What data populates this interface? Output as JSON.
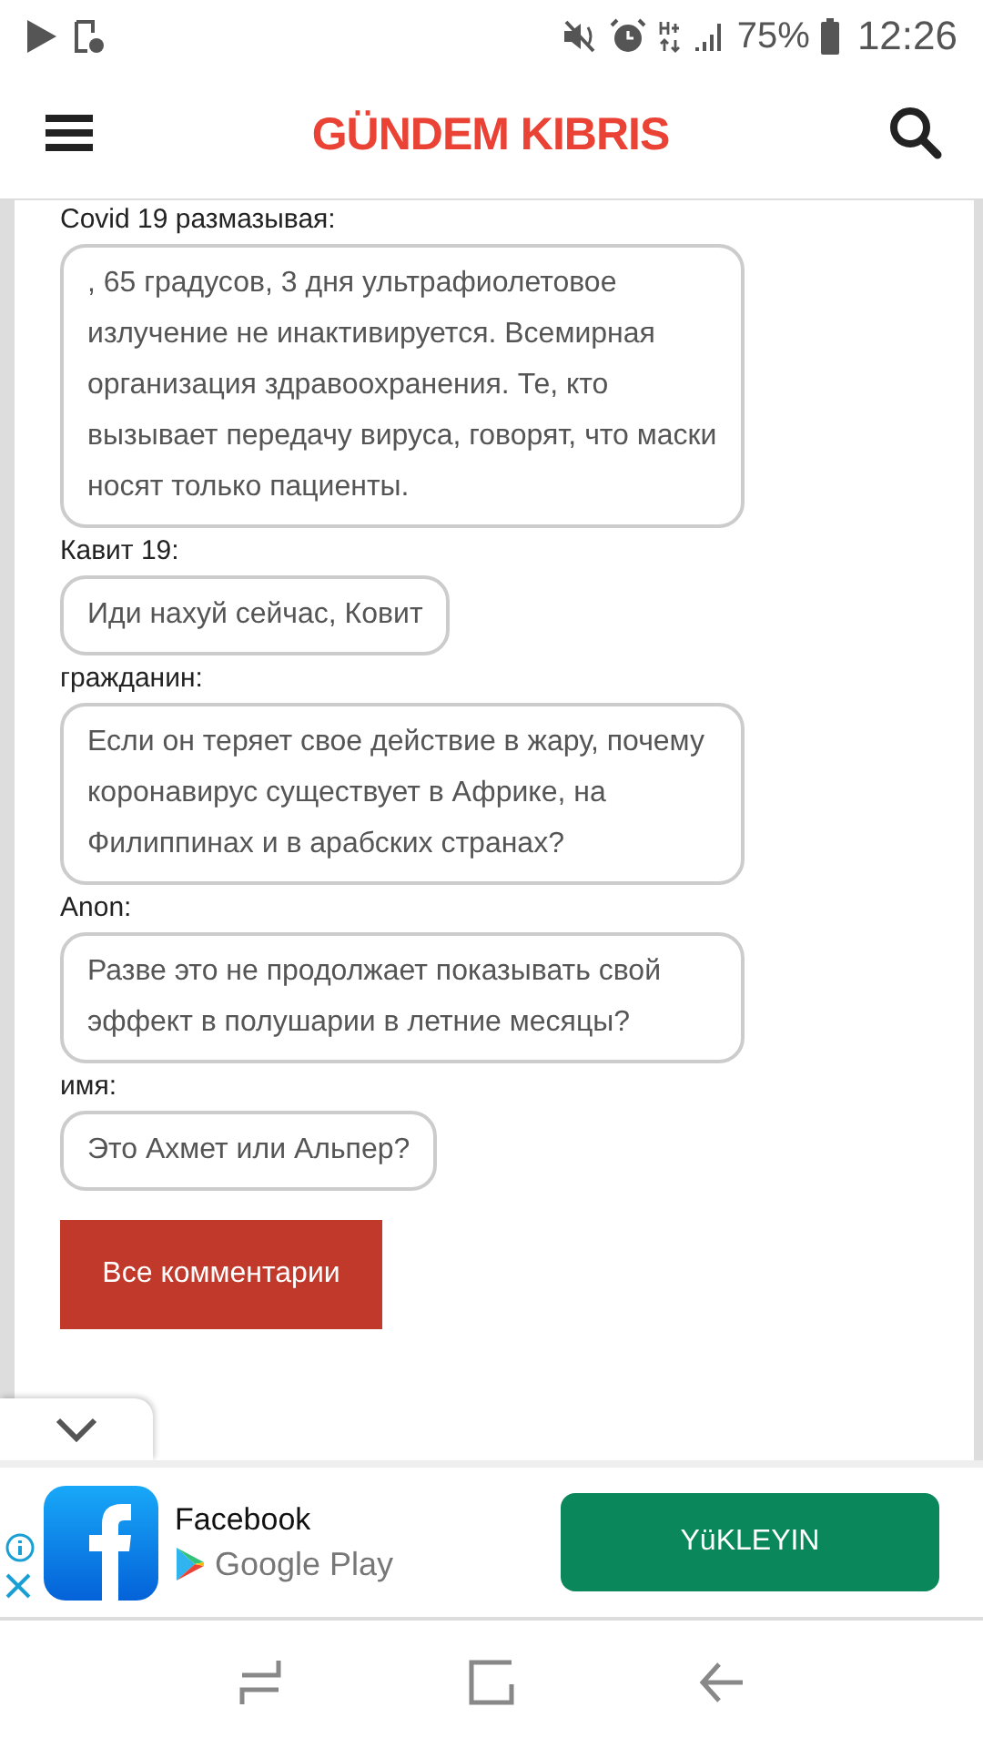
{
  "status_bar": {
    "battery": "75%",
    "time": "12:26"
  },
  "header": {
    "logo": "GÜNDEM KIBRIS"
  },
  "comments": [
    {
      "author": "Covid 19 размазывая:",
      "text": ", 65 градусов, 3 дня ультрафиолетовое излучение не инактивируется. Всемирная организация здравоохранения. Те, кто вызывает передачу вируса, говорят, что маски носят только пациенты."
    },
    {
      "author": "Кавит 19:",
      "text": "Иди нахуй сейчас, Ковит"
    },
    {
      "author": "гражданин:",
      "text": "Если он теряет свое действие в жару, почему коронавирус существует в Африке, на Филиппинах и в арабских странах?"
    },
    {
      "author": "Anon:",
      "text": "Разве это не продолжает показывать свой эффект в полушарии в летние месяцы?"
    },
    {
      "author": "имя:",
      "text": "Это Ахмет или Альпер?"
    }
  ],
  "all_comments_button": "Все комментарии",
  "ad": {
    "app_name": "Facebook",
    "store": "Google Play",
    "button": "YüKLEYIN"
  }
}
